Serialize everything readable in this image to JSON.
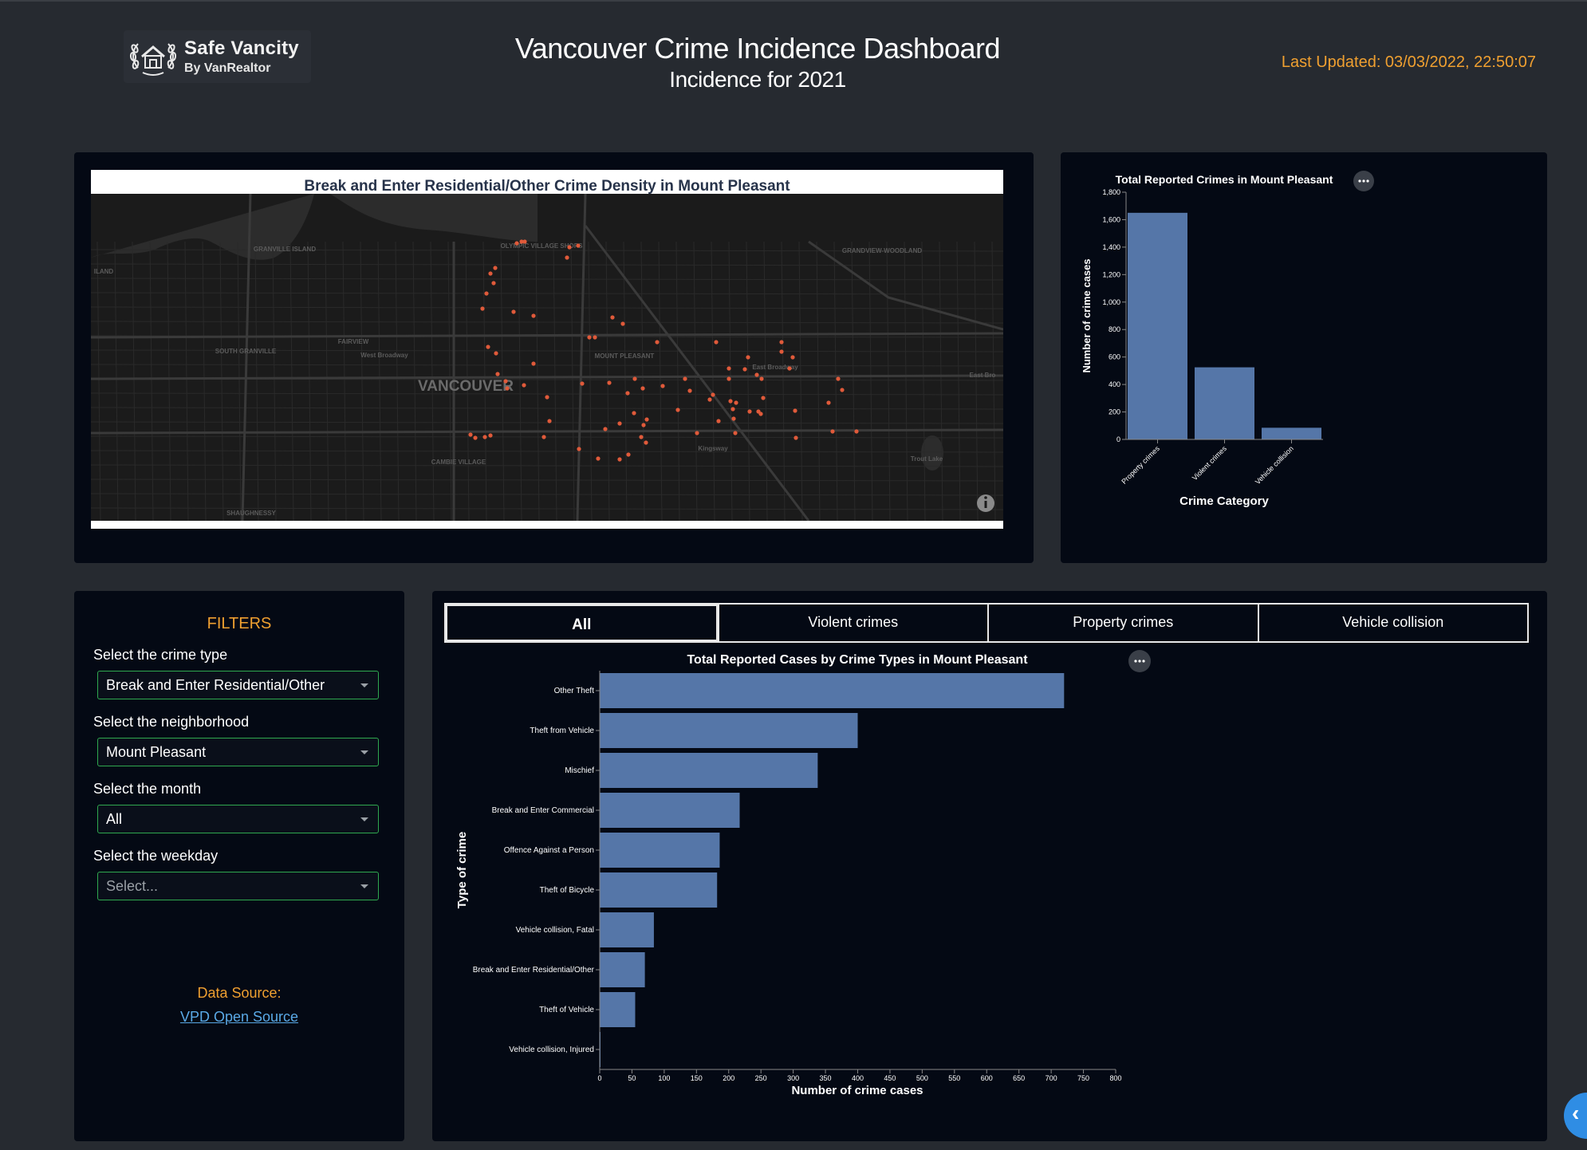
{
  "header": {
    "logo_title": "Safe Vancity",
    "logo_sub": "By VanRealtor",
    "title": "Vancouver Crime Incidence Dashboard",
    "subtitle": "Incidence for 2021",
    "last_updated": "Last Updated: 03/03/2022, 22:50:07"
  },
  "map": {
    "title": "Break and Enter Residential/Other Crime Density in Mount Pleasant",
    "place_labels": [
      {
        "text": "VANCOUVER",
        "major": true
      },
      {
        "text": "GRANVILLE ISLAND",
        "major": false
      },
      {
        "text": "FAIRVIEW",
        "major": false
      },
      {
        "text": "SOUTH GRANVILLE",
        "major": false
      },
      {
        "text": "MOUNT PLEASANT",
        "major": false
      },
      {
        "text": "CAMBIE VILLAGE",
        "major": false
      },
      {
        "text": "SHAUGHNESSY",
        "major": false
      },
      {
        "text": "GRANDVIEW-WOODLAND",
        "major": false
      },
      {
        "text": "OLYMPIC VILLAGE SHOPS",
        "major": false
      },
      {
        "text": "West Broadway",
        "major": false
      },
      {
        "text": "East Broadway",
        "major": false
      },
      {
        "text": "Kingsway",
        "major": false
      },
      {
        "text": "Trout Lake",
        "major": false
      },
      {
        "text": "East Bro",
        "major": false
      },
      {
        "text": "ILAND",
        "major": false
      }
    ],
    "point_color": "#e05a3a",
    "info_icon": "info-icon"
  },
  "category_chart": {
    "chart_data": {
      "type": "bar",
      "title": "Total Reported Crimes in Mount Pleasant",
      "categories": [
        "Property crimes",
        "Violent crimes",
        "Vehicle collision"
      ],
      "values": [
        1650,
        525,
        85
      ],
      "xlabel": "Crime Category",
      "ylabel": "Number of crime cases",
      "ylim": [
        0,
        1800
      ],
      "yticks": [
        0,
        200,
        400,
        600,
        800,
        1000,
        1200,
        1400,
        1600,
        1800
      ],
      "ytick_labels": [
        "0",
        "200",
        "400",
        "600",
        "800",
        "1,000",
        "1,200",
        "1,400",
        "1,600",
        "1,800"
      ],
      "bar_color": "#5576a8",
      "grid": false
    }
  },
  "filters": {
    "heading": "FILTERS",
    "crime_type_label": "Select the crime type",
    "crime_type_value": "Break and Enter Residential/Other",
    "neighborhood_label": "Select the neighborhood",
    "neighborhood_value": "Mount Pleasant",
    "month_label": "Select the month",
    "month_value": "All",
    "weekday_label": "Select the weekday",
    "weekday_placeholder": "Select...",
    "data_source_label": "Data Source:",
    "data_source_link": "VPD Open Source",
    "accent_color": "#f0a030",
    "select_border_color": "#2fa84f"
  },
  "tabs": {
    "all": "All",
    "violent": "Violent crimes",
    "property": "Property crimes",
    "vehicle": "Vehicle collision",
    "active": "All"
  },
  "types_chart": {
    "chart_data": {
      "type": "bar",
      "orientation": "horizontal",
      "title": "Total Reported Cases by Crime Types in Mount Pleasant",
      "categories": [
        "Other Theft",
        "Theft from Vehicle",
        "Mischief",
        "Break and Enter Commercial",
        "Offence Against a Person",
        "Theft of Bicycle",
        "Vehicle collision, Fatal",
        "Break and Enter Residential/Other",
        "Theft of Vehicle",
        "Vehicle collision, Injured"
      ],
      "values": [
        720,
        400,
        338,
        217,
        186,
        182,
        84,
        70,
        55,
        1
      ],
      "xlabel": "Number of crime cases",
      "ylabel": "Type of crime",
      "xlim": [
        0,
        800
      ],
      "xticks": [
        0,
        50,
        100,
        150,
        200,
        250,
        300,
        350,
        400,
        450,
        500,
        550,
        600,
        650,
        700,
        750,
        800
      ],
      "bar_color": "#5576a8",
      "grid": false
    }
  }
}
